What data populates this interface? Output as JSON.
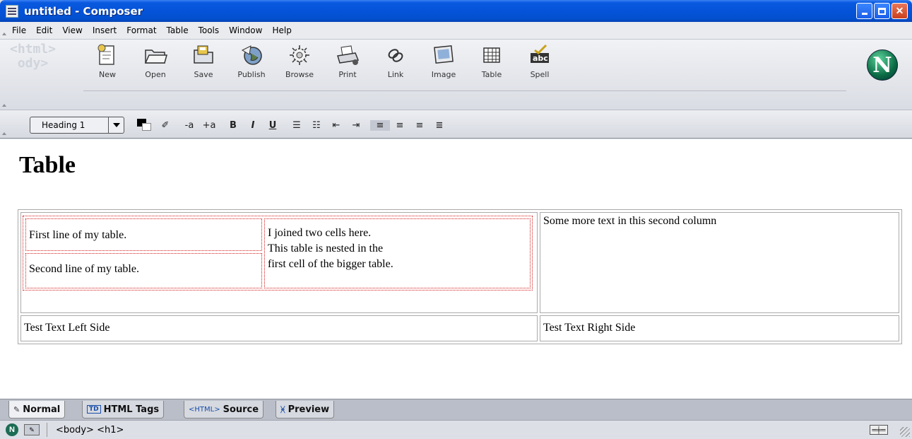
{
  "window": {
    "title": "untitled - Composer"
  },
  "menu": [
    "File",
    "Edit",
    "View",
    "Insert",
    "Format",
    "Table",
    "Tools",
    "Window",
    "Help"
  ],
  "toolbar": {
    "buttons": [
      {
        "label": "New",
        "icon": "new-page-icon"
      },
      {
        "label": "Open",
        "icon": "folder-icon"
      },
      {
        "label": "Save",
        "icon": "save-icon"
      },
      {
        "label": "Publish",
        "icon": "globe-icon"
      },
      {
        "label": "Browse",
        "icon": "gear-icon"
      },
      {
        "label": "Print",
        "icon": "printer-icon"
      },
      {
        "label": "Link",
        "icon": "chain-link-icon"
      },
      {
        "label": "Image",
        "icon": "image-icon"
      },
      {
        "label": "Table",
        "icon": "table-icon"
      },
      {
        "label": "Spell",
        "icon": "spellcheck-icon"
      }
    ]
  },
  "format": {
    "paragraph_style": "Heading 1",
    "fg_color": "#000000",
    "bg_color": "#ffffff",
    "tools": [
      {
        "glyph": "✐",
        "name": "highlight-pencil-icon"
      },
      {
        "glyph": "-a",
        "name": "smaller-font-button"
      },
      {
        "glyph": "+a",
        "name": "larger-font-button"
      },
      {
        "glyph": "B",
        "name": "bold-button"
      },
      {
        "glyph": "I",
        "name": "italic-button"
      },
      {
        "glyph": "U",
        "name": "underline-button"
      },
      {
        "glyph": "☰",
        "name": "bullet-list-button"
      },
      {
        "glyph": "☷",
        "name": "numbered-list-button"
      },
      {
        "glyph": "⇤",
        "name": "outdent-button"
      },
      {
        "glyph": "⇥",
        "name": "indent-button"
      },
      {
        "glyph": "≡",
        "name": "align-left-button"
      },
      {
        "glyph": "≡",
        "name": "align-center-button"
      },
      {
        "glyph": "≡",
        "name": "align-right-button"
      },
      {
        "glyph": "≣",
        "name": "justify-button"
      }
    ]
  },
  "document": {
    "heading": "Table",
    "nested": {
      "r1c1": "First line of my table.",
      "r2c1": "Second line of my table.",
      "joined_lines": [
        "I joined two cells here.",
        "This table is nested in the",
        "first cell of the bigger table."
      ]
    },
    "second_column": "Some more text in this second column",
    "bottom_left": "Test Text Left Side",
    "bottom_right": "Test Text Right Side"
  },
  "modes": [
    {
      "label": "Normal",
      "icon": "pencil-icon",
      "icon_text": "✎"
    },
    {
      "label": "HTML Tags",
      "icon": "td-tag-icon",
      "icon_text": "TD"
    },
    {
      "label": "Source",
      "icon": "html-tag-icon",
      "icon_text": "<HTML>"
    },
    {
      "label": "Preview",
      "icon": "preview-icon",
      "icon_text": "ᚸ"
    }
  ],
  "status": {
    "breadcrumbs": "<body> <h1>"
  }
}
